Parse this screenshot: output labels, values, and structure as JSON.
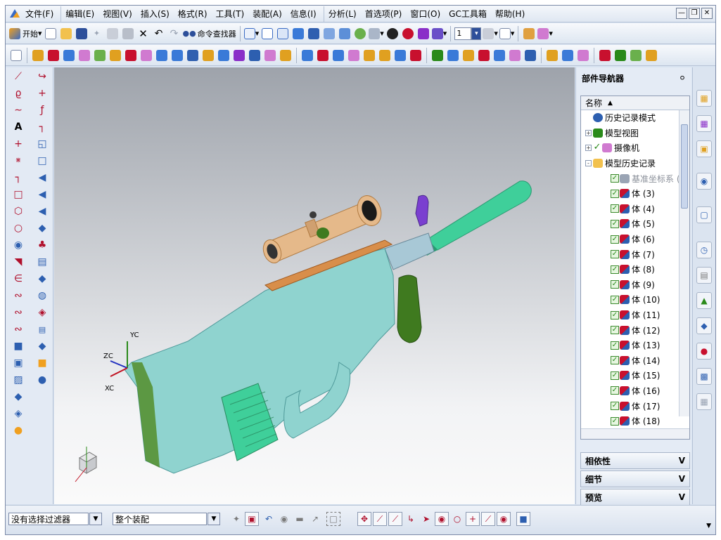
{
  "menu": {
    "items": [
      "文件(F)",
      "编辑(E)",
      "视图(V)",
      "插入(S)",
      "格式(R)",
      "工具(T)",
      "装配(A)",
      "信息(I)",
      "分析(L)",
      "首选项(P)",
      "窗口(O)",
      "GC工具箱",
      "帮助(H)"
    ]
  },
  "toolbar1": {
    "start_label": "开始",
    "command_finder_label": "命令查找器",
    "layer_value": "1"
  },
  "viewport": {
    "axis_yc": "YC",
    "axis_zc": "ZC",
    "axis_xc": "XC",
    "colors": {
      "body": "#8fd3cf",
      "grip": "#3f7a1f",
      "suppressor": "#3fcf9a",
      "scope": "#e5b98a",
      "bracket": "#d88e4a",
      "lever": "#7a3fd0"
    }
  },
  "navigator": {
    "title": "部件导航器",
    "column_name": "名称",
    "sort_arrow": "▲",
    "rows": [
      {
        "label": "历史记录模式",
        "level": 0,
        "icon": "clock-icon",
        "check": false,
        "expander": ""
      },
      {
        "label": "模型视图",
        "level": 0,
        "icon": "model-view-icon",
        "check": false,
        "expander": "+"
      },
      {
        "label": "摄像机",
        "level": 0,
        "icon": "camera-icon",
        "check": true,
        "expander": "+"
      },
      {
        "label": "模型历史记录",
        "level": 0,
        "icon": "folder-icon",
        "check": false,
        "expander": "-"
      },
      {
        "label": "基准坐标系 (",
        "level": 1,
        "icon": "datum-csys-icon",
        "check": true,
        "expander": "",
        "dim": true
      },
      {
        "label": "体 (3)",
        "level": 1,
        "icon": "body-icon",
        "check": true,
        "expander": ""
      },
      {
        "label": "体 (4)",
        "level": 1,
        "icon": "body-icon",
        "check": true,
        "expander": ""
      },
      {
        "label": "体 (5)",
        "level": 1,
        "icon": "body-icon",
        "check": true,
        "expander": ""
      },
      {
        "label": "体 (6)",
        "level": 1,
        "icon": "body-icon",
        "check": true,
        "expander": ""
      },
      {
        "label": "体 (7)",
        "level": 1,
        "icon": "body-icon",
        "check": true,
        "expander": ""
      },
      {
        "label": "体 (8)",
        "level": 1,
        "icon": "body-icon",
        "check": true,
        "expander": ""
      },
      {
        "label": "体 (9)",
        "level": 1,
        "icon": "body-icon",
        "check": true,
        "expander": ""
      },
      {
        "label": "体 (10)",
        "level": 1,
        "icon": "body-icon",
        "check": true,
        "expander": ""
      },
      {
        "label": "体 (11)",
        "level": 1,
        "icon": "body-icon",
        "check": true,
        "expander": ""
      },
      {
        "label": "体 (12)",
        "level": 1,
        "icon": "body-icon",
        "check": true,
        "expander": ""
      },
      {
        "label": "体 (13)",
        "level": 1,
        "icon": "body-icon",
        "check": true,
        "expander": ""
      },
      {
        "label": "体 (14)",
        "level": 1,
        "icon": "body-icon",
        "check": true,
        "expander": ""
      },
      {
        "label": "体 (15)",
        "level": 1,
        "icon": "body-icon",
        "check": true,
        "expander": ""
      },
      {
        "label": "体 (16)",
        "level": 1,
        "icon": "body-icon",
        "check": true,
        "expander": ""
      },
      {
        "label": "体 (17)",
        "level": 1,
        "icon": "body-icon",
        "check": true,
        "expander": ""
      },
      {
        "label": "体 (18)",
        "level": 1,
        "icon": "body-icon",
        "check": true,
        "expander": ""
      }
    ],
    "panels": [
      {
        "label": "相依性",
        "arrow": "V"
      },
      {
        "label": "细节",
        "arrow": "V"
      },
      {
        "label": "预览",
        "arrow": "V"
      }
    ]
  },
  "statusbar": {
    "filter_value": "没有选择过滤器",
    "scope_value": "整个装配"
  }
}
